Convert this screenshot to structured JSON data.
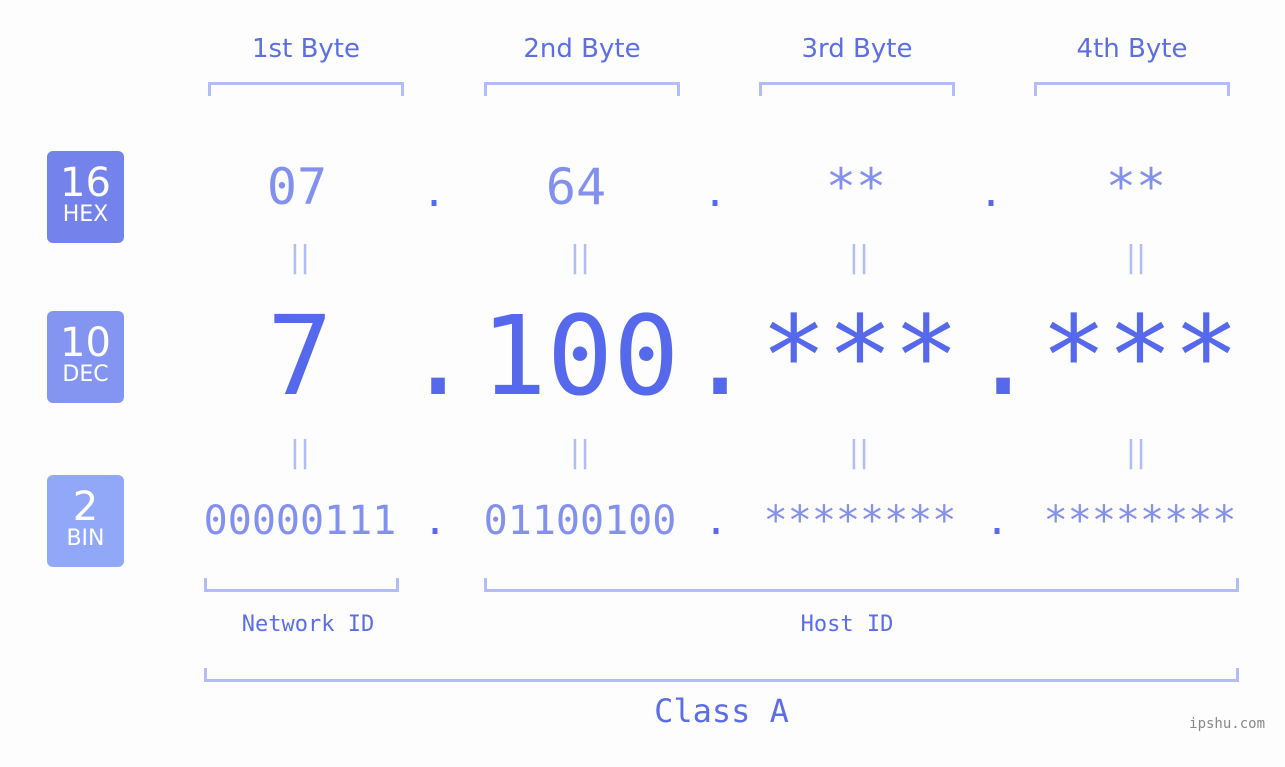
{
  "byte_headers": [
    "1st Byte",
    "2nd Byte",
    "3rd Byte",
    "4th Byte"
  ],
  "badges": [
    {
      "num": "16",
      "label": "HEX",
      "color": "#7383eb"
    },
    {
      "num": "10",
      "label": "DEC",
      "color": "#8495f1"
    },
    {
      "num": "2",
      "label": "BIN",
      "color": "#91a8f8"
    }
  ],
  "hex": [
    "07",
    "64",
    "**",
    "**"
  ],
  "dec": [
    "7",
    "100",
    "***",
    "***"
  ],
  "bin": [
    "00000111",
    "01100100",
    "********",
    "********"
  ],
  "separator": ".",
  "equals": "||",
  "network_id_label": "Network ID",
  "host_id_label": "Host ID",
  "class_label": "Class A",
  "watermark": "ipshu.com",
  "colors": {
    "primary": "#5669ec",
    "light": "#8290ee",
    "bracket": "#b2bcf6"
  }
}
